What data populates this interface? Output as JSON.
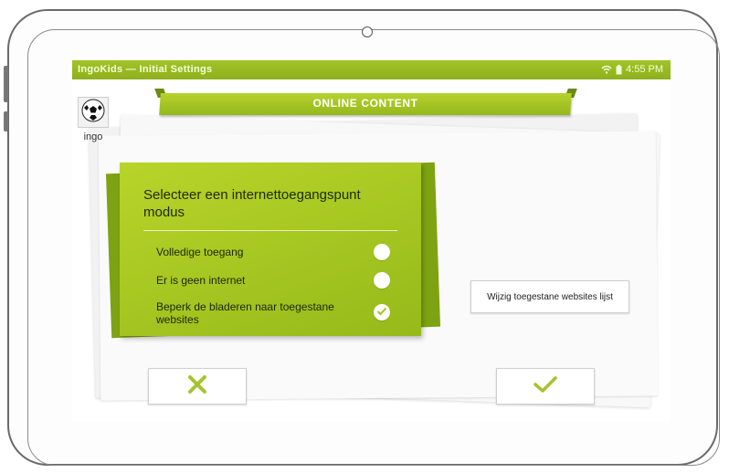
{
  "statusbar": {
    "app_title": "IngoKids — Initial Settings",
    "time": "4:55 PM",
    "wifi_icon": "wifi-icon",
    "battery_icon": "battery-icon"
  },
  "header": {
    "title": "ONLINE CONTENT"
  },
  "user": {
    "name": "ingo",
    "avatar_icon": "soccer-ball-icon"
  },
  "panel": {
    "title": "Selecteer een internettoegangspunt modus",
    "options": [
      {
        "label": "Volledige toegang",
        "selected": false
      },
      {
        "label": "Er is geen internet",
        "selected": false
      },
      {
        "label": "Beperk de bladeren naar toegestane websites",
        "selected": true
      }
    ]
  },
  "buttons": {
    "change_websites": "Wijzig toegestane websites lijst",
    "cancel_icon": "close-icon",
    "confirm_icon": "checkmark-icon"
  },
  "colors": {
    "accent": "#a3c327",
    "accent_dark": "#7ea312",
    "icon_green": "#a4c42c"
  }
}
